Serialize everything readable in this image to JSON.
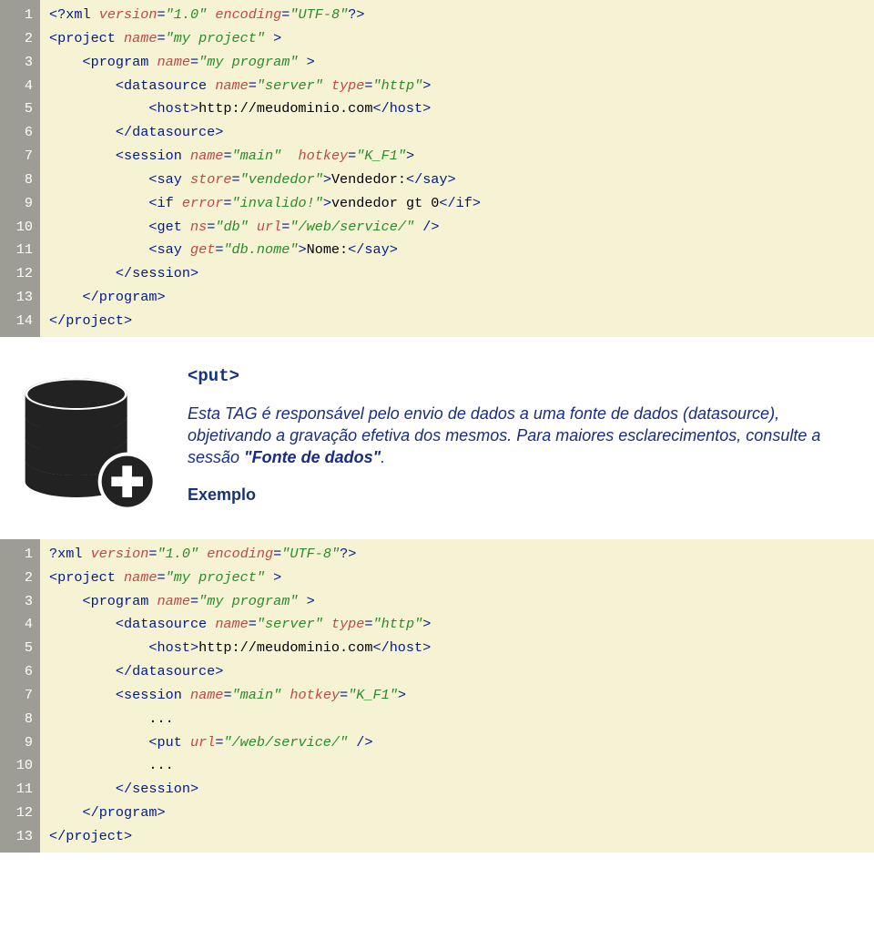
{
  "block1": {
    "gutter": [
      "1",
      "2",
      "3",
      "4",
      "5",
      "6",
      "7",
      "8",
      "9",
      "10",
      "11",
      "12",
      "13",
      "14"
    ],
    "lines": [
      [
        [
          "tag",
          "<?xml"
        ],
        [
          "text",
          " "
        ],
        [
          "attr",
          "version"
        ],
        [
          "tag",
          "="
        ],
        [
          "str",
          "\"1.0\""
        ],
        [
          "text",
          " "
        ],
        [
          "attr",
          "encoding"
        ],
        [
          "tag",
          "="
        ],
        [
          "str",
          "\"UTF-8\""
        ],
        [
          "tag",
          "?>"
        ]
      ],
      [
        [
          "tag",
          "<project"
        ],
        [
          "text",
          " "
        ],
        [
          "attr",
          "name"
        ],
        [
          "tag",
          "="
        ],
        [
          "str",
          "\"my project\""
        ],
        [
          "text",
          " "
        ],
        [
          "tag",
          ">"
        ]
      ],
      [
        [
          "text",
          "    "
        ],
        [
          "tag",
          "<program"
        ],
        [
          "text",
          " "
        ],
        [
          "attr",
          "name"
        ],
        [
          "tag",
          "="
        ],
        [
          "str",
          "\"my program\""
        ],
        [
          "text",
          " "
        ],
        [
          "tag",
          ">"
        ]
      ],
      [
        [
          "text",
          "        "
        ],
        [
          "tag",
          "<datasource"
        ],
        [
          "text",
          " "
        ],
        [
          "attr",
          "name"
        ],
        [
          "tag",
          "="
        ],
        [
          "str",
          "\"server\""
        ],
        [
          "text",
          " "
        ],
        [
          "attr",
          "type"
        ],
        [
          "tag",
          "="
        ],
        [
          "str",
          "\"http\""
        ],
        [
          "tag",
          ">"
        ]
      ],
      [
        [
          "text",
          "            "
        ],
        [
          "tag",
          "<host>"
        ],
        [
          "text",
          "http://meudominio.com"
        ],
        [
          "tag",
          "</host>"
        ]
      ],
      [
        [
          "text",
          "        "
        ],
        [
          "tag",
          "</datasource>"
        ]
      ],
      [
        [
          "text",
          "        "
        ],
        [
          "tag",
          "<session"
        ],
        [
          "text",
          " "
        ],
        [
          "attr",
          "name"
        ],
        [
          "tag",
          "="
        ],
        [
          "str",
          "\"main\""
        ],
        [
          "text",
          "  "
        ],
        [
          "attr",
          "hotkey"
        ],
        [
          "tag",
          "="
        ],
        [
          "str",
          "\"K_F1\""
        ],
        [
          "tag",
          ">"
        ]
      ],
      [
        [
          "text",
          "            "
        ],
        [
          "tag",
          "<say"
        ],
        [
          "text",
          " "
        ],
        [
          "attr",
          "store"
        ],
        [
          "tag",
          "="
        ],
        [
          "str",
          "\"vendedor\""
        ],
        [
          "tag",
          ">"
        ],
        [
          "text",
          "Vendedor:"
        ],
        [
          "tag",
          "</say>"
        ]
      ],
      [
        [
          "text",
          "            "
        ],
        [
          "tag",
          "<if"
        ],
        [
          "text",
          " "
        ],
        [
          "attr",
          "error"
        ],
        [
          "tag",
          "="
        ],
        [
          "str",
          "\"invalido!\""
        ],
        [
          "tag",
          ">"
        ],
        [
          "text",
          "vendedor gt 0"
        ],
        [
          "tag",
          "</if>"
        ]
      ],
      [
        [
          "text",
          "            "
        ],
        [
          "tag",
          "<get"
        ],
        [
          "text",
          " "
        ],
        [
          "attr",
          "ns"
        ],
        [
          "tag",
          "="
        ],
        [
          "str",
          "\"db\""
        ],
        [
          "text",
          " "
        ],
        [
          "attr",
          "url"
        ],
        [
          "tag",
          "="
        ],
        [
          "str",
          "\"/web/service/\""
        ],
        [
          "text",
          " "
        ],
        [
          "tag",
          "/>"
        ]
      ],
      [
        [
          "text",
          "            "
        ],
        [
          "tag",
          "<say"
        ],
        [
          "text",
          " "
        ],
        [
          "attr",
          "get"
        ],
        [
          "tag",
          "="
        ],
        [
          "str",
          "\"db.nome\""
        ],
        [
          "tag",
          ">"
        ],
        [
          "text",
          "Nome:"
        ],
        [
          "tag",
          "</say>"
        ]
      ],
      [
        [
          "text",
          "        "
        ],
        [
          "tag",
          "</session>"
        ]
      ],
      [
        [
          "text",
          "    "
        ],
        [
          "tag",
          "</program>"
        ]
      ],
      [
        [
          "tag",
          "</project>"
        ]
      ]
    ]
  },
  "section": {
    "tag_title": "<put>",
    "desc_parts": {
      "p1": "Esta TAG é responsável pelo envio de dados a uma fonte de dados (datasource), objetivando a gravação efetiva dos mesmos. Para maiores esclarecimentos, consulte a sessão ",
      "bold": "\"Fonte de dados\"",
      "p2": "."
    },
    "example_label": "Exemplo"
  },
  "block2": {
    "gutter": [
      "1",
      "2",
      "3",
      "4",
      "5",
      "6",
      "7",
      "8",
      "9",
      "10",
      "11",
      "12",
      "13"
    ],
    "lines": [
      [
        [
          "tag",
          "?xml"
        ],
        [
          "text",
          " "
        ],
        [
          "attr",
          "version"
        ],
        [
          "tag",
          "="
        ],
        [
          "str",
          "\"1.0\""
        ],
        [
          "text",
          " "
        ],
        [
          "attr",
          "encoding"
        ],
        [
          "tag",
          "="
        ],
        [
          "str",
          "\"UTF-8\""
        ],
        [
          "tag",
          "?>"
        ]
      ],
      [
        [
          "tag",
          "<project"
        ],
        [
          "text",
          " "
        ],
        [
          "attr",
          "name"
        ],
        [
          "tag",
          "="
        ],
        [
          "str",
          "\"my project\""
        ],
        [
          "text",
          " "
        ],
        [
          "tag",
          ">"
        ]
      ],
      [
        [
          "text",
          "    "
        ],
        [
          "tag",
          "<program"
        ],
        [
          "text",
          " "
        ],
        [
          "attr",
          "name"
        ],
        [
          "tag",
          "="
        ],
        [
          "str",
          "\"my program\""
        ],
        [
          "text",
          " "
        ],
        [
          "tag",
          ">"
        ]
      ],
      [
        [
          "text",
          "        "
        ],
        [
          "tag",
          "<datasource"
        ],
        [
          "text",
          " "
        ],
        [
          "attr",
          "name"
        ],
        [
          "tag",
          "="
        ],
        [
          "str",
          "\"server\""
        ],
        [
          "text",
          " "
        ],
        [
          "attr",
          "type"
        ],
        [
          "tag",
          "="
        ],
        [
          "str",
          "\"http\""
        ],
        [
          "tag",
          ">"
        ]
      ],
      [
        [
          "text",
          "            "
        ],
        [
          "tag",
          "<host>"
        ],
        [
          "text",
          "http://meudominio.com"
        ],
        [
          "tag",
          "</host>"
        ]
      ],
      [
        [
          "text",
          "        "
        ],
        [
          "tag",
          "</datasource>"
        ]
      ],
      [
        [
          "text",
          "        "
        ],
        [
          "tag",
          "<session"
        ],
        [
          "text",
          " "
        ],
        [
          "attr",
          "name"
        ],
        [
          "tag",
          "="
        ],
        [
          "str",
          "\"main\""
        ],
        [
          "text",
          " "
        ],
        [
          "attr",
          "hotkey"
        ],
        [
          "tag",
          "="
        ],
        [
          "str",
          "\"K_F1\""
        ],
        [
          "tag",
          ">"
        ]
      ],
      [
        [
          "text",
          "            "
        ],
        [
          "text",
          "..."
        ]
      ],
      [
        [
          "text",
          "            "
        ],
        [
          "tag",
          "<put"
        ],
        [
          "text",
          " "
        ],
        [
          "attr",
          "url"
        ],
        [
          "tag",
          "="
        ],
        [
          "str",
          "\"/web/service/\""
        ],
        [
          "text",
          " "
        ],
        [
          "tag",
          "/>"
        ]
      ],
      [
        [
          "text",
          "            "
        ],
        [
          "text",
          "..."
        ]
      ],
      [
        [
          "text",
          "        "
        ],
        [
          "tag",
          "</session>"
        ]
      ],
      [
        [
          "text",
          "    "
        ],
        [
          "tag",
          "</program>"
        ]
      ],
      [
        [
          "tag",
          "</project>"
        ]
      ]
    ]
  }
}
